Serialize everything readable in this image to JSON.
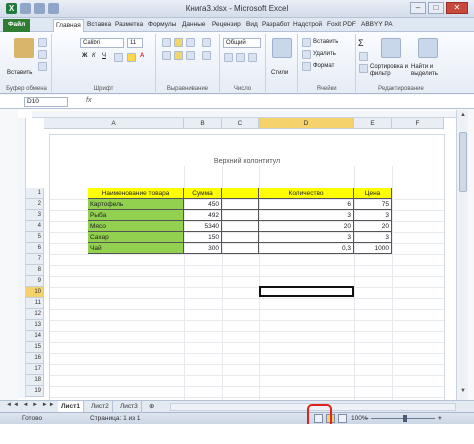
{
  "window": {
    "title": "Книга3.xlsx - Microsoft Excel"
  },
  "ribbon_tabs": [
    "Файл",
    "Главная",
    "Вставка",
    "Разметка",
    "Формулы",
    "Данные",
    "Рецензир",
    "Вид",
    "Разработ",
    "Надстрой",
    "Foxit PDF",
    "ABBYY PA"
  ],
  "ribbon": {
    "paste_label": "Вставить",
    "font_name": "Calibri",
    "font_size": "11",
    "number_format": "Общий",
    "styles_label": "Стили",
    "insert_label": "Вставить",
    "delete_label": "Удалить",
    "format_label": "Формат",
    "sort_label": "Сортировка и фильтр",
    "find_label": "Найти и выделить",
    "groups": [
      "Буфер обмена",
      "Шрифт",
      "Выравнивание",
      "Число",
      "Ячейки",
      "Редактирование"
    ]
  },
  "formula_bar": {
    "name_box": "D10",
    "fx": "fx"
  },
  "columns": [
    "A",
    "B",
    "C",
    "D",
    "E",
    "F"
  ],
  "rows": [
    "1",
    "2",
    "3",
    "4",
    "5",
    "6",
    "7",
    "8",
    "9",
    "10",
    "11",
    "12",
    "13",
    "14",
    "15",
    "16",
    "17",
    "18",
    "19",
    "20",
    "21",
    "22",
    "23"
  ],
  "header_text": "Верхний колонтитул",
  "table": {
    "headers": [
      "Наименование товара",
      "Сумма",
      "",
      "Количество",
      "Цена"
    ],
    "rows": [
      [
        "Картофель",
        "450",
        "",
        "6",
        "75"
      ],
      [
        "Рыба",
        "492",
        "",
        "3",
        "3"
      ],
      [
        "Мясо",
        "5340",
        "",
        "20",
        "20"
      ],
      [
        "Сахар",
        "150",
        "",
        "3",
        "3"
      ],
      [
        "Чай",
        "300",
        "",
        "0,3",
        "1000"
      ]
    ]
  },
  "sheets": [
    "Лист1",
    "Лист2",
    "Лист3"
  ],
  "status": {
    "ready": "Готово",
    "page": "Страница: 1 из 1",
    "zoom": "100%"
  },
  "colors": {
    "header_fill": "#ffff00",
    "name_fill": "#92d050",
    "highlight": "#e2211c"
  }
}
